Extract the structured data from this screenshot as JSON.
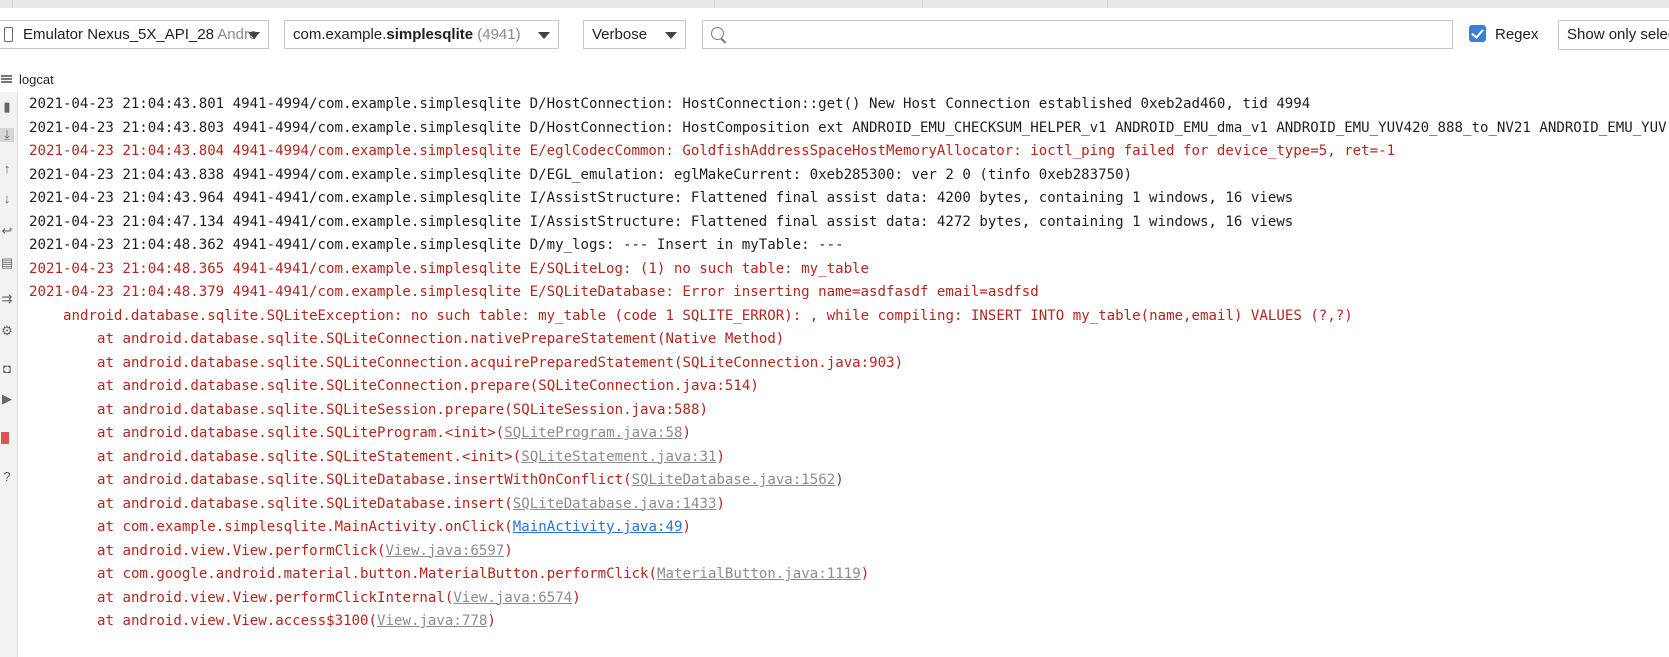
{
  "toolbar": {
    "device": {
      "name": "Emulator Nexus_5X_API_28",
      "suffix": " Andro"
    },
    "process": {
      "prefix": "com.example.",
      "bold": "simplesqlite",
      "pid": " (4941)"
    },
    "level": "Verbose",
    "search": {
      "value": "",
      "placeholder": ""
    },
    "regex": {
      "label": "Regex",
      "checked": true
    },
    "show_only": "Show only selected application"
  },
  "tab": {
    "label": "logcat"
  },
  "sidebar": {
    "icons": [
      "trash-icon",
      "scroll-to-end-icon",
      "up-arrow-icon",
      "down-arrow-icon",
      "soft-wrap-icon",
      "print-icon",
      "restart-icon",
      "settings-icon",
      "camera-icon",
      "video-icon",
      "stop-icon",
      "help-icon"
    ]
  },
  "colors": {
    "error": "#b3261e",
    "normal": "#1f1f1f",
    "link_gray": "#8c8c8c",
    "link_blue": "#2a6fd8",
    "accent": "#3d7fd6"
  },
  "log": {
    "lines": [
      {
        "level": "normal",
        "indent": 0,
        "text": "2021-04-23 21:04:43.801 4941-4994/com.example.simplesqlite D/HostConnection: HostConnection::get() New Host Connection established 0xeb2ad460, tid 4994"
      },
      {
        "level": "normal",
        "indent": 0,
        "text": "2021-04-23 21:04:43.803 4941-4994/com.example.simplesqlite D/HostConnection: HostComposition ext ANDROID_EMU_CHECKSUM_HELPER_v1 ANDROID_EMU_dma_v1 ANDROID_EMU_YUV420_888_to_NV21 ANDROID_EMU_YUV"
      },
      {
        "level": "error",
        "indent": 0,
        "text": "2021-04-23 21:04:43.804 4941-4994/com.example.simplesqlite E/eglCodecCommon: GoldfishAddressSpaceHostMemoryAllocator: ioctl_ping failed for device_type=5, ret=-1"
      },
      {
        "level": "normal",
        "indent": 0,
        "text": "2021-04-23 21:04:43.838 4941-4994/com.example.simplesqlite D/EGL_emulation: eglMakeCurrent: 0xeb285300: ver 2 0 (tinfo 0xeb283750)"
      },
      {
        "level": "normal",
        "indent": 0,
        "text": "2021-04-23 21:04:43.964 4941-4941/com.example.simplesqlite I/AssistStructure: Flattened final assist data: 4200 bytes, containing 1 windows, 16 views"
      },
      {
        "level": "normal",
        "indent": 0,
        "text": "2021-04-23 21:04:47.134 4941-4941/com.example.simplesqlite I/AssistStructure: Flattened final assist data: 4272 bytes, containing 1 windows, 16 views"
      },
      {
        "level": "normal",
        "indent": 0,
        "text": "2021-04-23 21:04:48.362 4941-4941/com.example.simplesqlite D/my_logs: --- Insert in myTable: ---"
      },
      {
        "level": "error",
        "indent": 0,
        "text": "2021-04-23 21:04:48.365 4941-4941/com.example.simplesqlite E/SQLiteLog: (1) no such table: my_table"
      },
      {
        "level": "error",
        "indent": 0,
        "text": "2021-04-23 21:04:48.379 4941-4941/com.example.simplesqlite E/SQLiteDatabase: Error inserting name=asdfasdf email=asdfsd"
      },
      {
        "level": "error",
        "indent": 1,
        "text": "android.database.sqlite.SQLiteException: no such table: my_table (code 1 SQLITE_ERROR): , while compiling: INSERT INTO my_table(name,email) VALUES (?,?)"
      },
      {
        "level": "error",
        "indent": 2,
        "text": "at android.database.sqlite.SQLiteConnection.nativePrepareStatement(Native Method)"
      },
      {
        "level": "error",
        "indent": 2,
        "text": "at android.database.sqlite.SQLiteConnection.acquirePreparedStatement(SQLiteConnection.java:903)"
      },
      {
        "level": "error",
        "indent": 2,
        "text": "at android.database.sqlite.SQLiteConnection.prepare(SQLiteConnection.java:514)"
      },
      {
        "level": "error",
        "indent": 2,
        "text": "at android.database.sqlite.SQLiteSession.prepare(SQLiteSession.java:588)"
      },
      {
        "level": "error",
        "indent": 2,
        "prefix": "at android.database.sqlite.SQLiteProgram.<init>(",
        "link": "SQLiteProgram.java:58",
        "link_style": "gray",
        "suffix": ")"
      },
      {
        "level": "error",
        "indent": 2,
        "prefix": "at android.database.sqlite.SQLiteStatement.<init>(",
        "link": "SQLiteStatement.java:31",
        "link_style": "gray",
        "suffix": ")"
      },
      {
        "level": "error",
        "indent": 2,
        "prefix": "at android.database.sqlite.SQLiteDatabase.insertWithOnConflict(",
        "link": "SQLiteDatabase.java:1562",
        "link_style": "gray",
        "suffix": ")"
      },
      {
        "level": "error",
        "indent": 2,
        "prefix": "at android.database.sqlite.SQLiteDatabase.insert(",
        "link": "SQLiteDatabase.java:1433",
        "link_style": "gray",
        "suffix": ")"
      },
      {
        "level": "error",
        "indent": 2,
        "prefix": "at com.example.simplesqlite.MainActivity.onClick(",
        "link": "MainActivity.java:49",
        "link_style": "blue",
        "suffix": ")"
      },
      {
        "level": "error",
        "indent": 2,
        "prefix": "at android.view.View.performClick(",
        "link": "View.java:6597",
        "link_style": "gray",
        "suffix": ")"
      },
      {
        "level": "error",
        "indent": 2,
        "prefix": "at com.google.android.material.button.MaterialButton.performClick(",
        "link": "MaterialButton.java:1119",
        "link_style": "gray",
        "suffix": ")"
      },
      {
        "level": "error",
        "indent": 2,
        "prefix": "at android.view.View.performClickInternal(",
        "link": "View.java:6574",
        "link_style": "gray",
        "suffix": ")"
      },
      {
        "level": "error",
        "indent": 2,
        "prefix": "at android.view.View.access$3100(",
        "link": "View.java:778",
        "link_style": "gray",
        "suffix": ")"
      }
    ]
  }
}
